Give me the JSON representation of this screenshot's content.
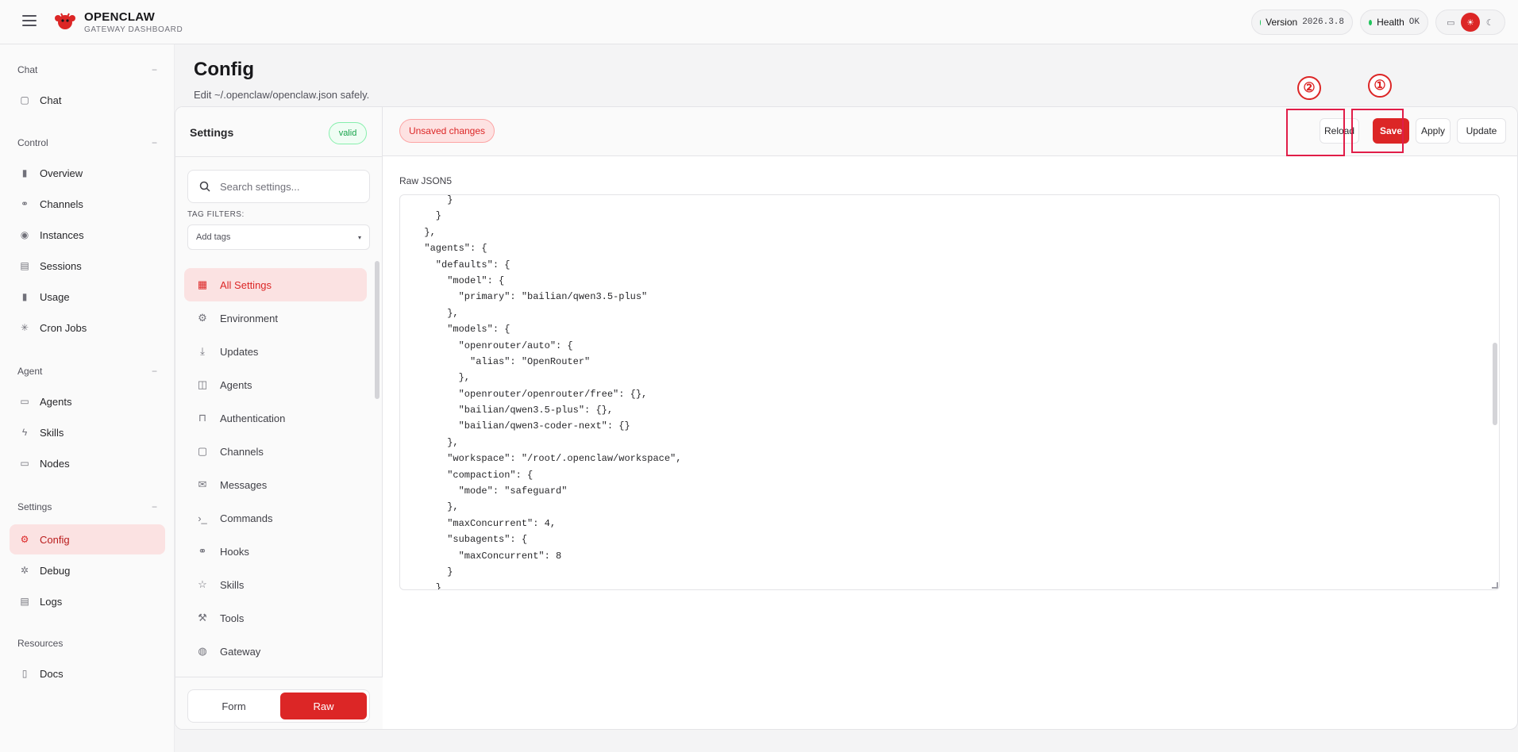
{
  "app": {
    "title": "OPENCLAW",
    "subtitle": "GATEWAY DASHBOARD"
  },
  "status": {
    "version_label": "Version",
    "version_value": "2026.3.8",
    "health_label": "Health",
    "health_value": "OK"
  },
  "theme": {
    "options": [
      "monitor-icon",
      "sun-icon",
      "moon-icon"
    ],
    "active": "sun-icon"
  },
  "nav": {
    "groups": [
      {
        "label": "Chat",
        "items": [
          {
            "label": "Chat",
            "icon": "message-icon"
          }
        ]
      },
      {
        "label": "Control",
        "items": [
          {
            "label": "Overview",
            "icon": "bar-chart-icon"
          },
          {
            "label": "Channels",
            "icon": "link-icon"
          },
          {
            "label": "Instances",
            "icon": "broadcast-icon"
          },
          {
            "label": "Sessions",
            "icon": "file-icon"
          },
          {
            "label": "Usage",
            "icon": "bar-chart-icon"
          },
          {
            "label": "Cron Jobs",
            "icon": "loader-icon"
          }
        ]
      },
      {
        "label": "Agent",
        "items": [
          {
            "label": "Agents",
            "icon": "folder-icon"
          },
          {
            "label": "Skills",
            "icon": "zap-icon"
          },
          {
            "label": "Nodes",
            "icon": "monitor-icon"
          }
        ]
      },
      {
        "label": "Settings",
        "items": [
          {
            "label": "Config",
            "icon": "gear-icon"
          },
          {
            "label": "Debug",
            "icon": "bug-icon"
          },
          {
            "label": "Logs",
            "icon": "scroll-icon"
          }
        ]
      },
      {
        "label": "Resources",
        "items": [
          {
            "label": "Docs",
            "icon": "book-icon"
          }
        ]
      }
    ],
    "collapse_symbol": "−",
    "active": "Config"
  },
  "page": {
    "title": "Config",
    "subtitle": "Edit ~/.openclaw/openclaw.json safely."
  },
  "settings_panel": {
    "title": "Settings",
    "badge": "valid",
    "search_placeholder": "Search settings...",
    "tag_filters_label": "TAG FILTERS:",
    "tag_placeholder": "Add tags",
    "sections": [
      {
        "label": "All Settings",
        "icon": "grid-icon"
      },
      {
        "label": "Environment",
        "icon": "gear-icon"
      },
      {
        "label": "Updates",
        "icon": "download-icon"
      },
      {
        "label": "Agents",
        "icon": "bot-icon"
      },
      {
        "label": "Authentication",
        "icon": "lock-icon"
      },
      {
        "label": "Channels",
        "icon": "message-icon"
      },
      {
        "label": "Messages",
        "icon": "mail-icon"
      },
      {
        "label": "Commands",
        "icon": "terminal-icon"
      },
      {
        "label": "Hooks",
        "icon": "link-icon"
      },
      {
        "label": "Skills",
        "icon": "star-icon"
      },
      {
        "label": "Tools",
        "icon": "wrench-icon"
      },
      {
        "label": "Gateway",
        "icon": "globe-icon"
      }
    ],
    "active_section": "All Settings",
    "mode_form": "Form",
    "mode_raw": "Raw",
    "mode_active": "Raw"
  },
  "toolbar": {
    "unsaved": "Unsaved changes",
    "reload": "Reload",
    "save": "Save",
    "apply": "Apply",
    "update": "Update",
    "annotation_save": "①",
    "annotation_reload": "②"
  },
  "editor": {
    "label": "Raw JSON5",
    "lines": [
      "      }",
      "    }",
      "  },",
      "  \"agents\": {",
      "    \"defaults\": {",
      "      \"model\": {",
      "        \"primary\": \"bailian/qwen3.5-plus\"",
      "      },",
      "      \"models\": {",
      "        \"openrouter/auto\": {",
      "          \"alias\": \"OpenRouter\"",
      "        },",
      "        \"openrouter/openrouter/free\": {},",
      "        \"bailian/qwen3.5-plus\": {},",
      "        \"bailian/qwen3-coder-next\": {}",
      "      },",
      "      \"workspace\": \"/root/.openclaw/workspace\",",
      "      \"compaction\": {",
      "        \"mode\": \"safeguard\"",
      "      },",
      "      \"maxConcurrent\": 4,",
      "      \"subagents\": {",
      "        \"maxConcurrent\": 8",
      "      }",
      "    }"
    ]
  },
  "colors": {
    "accent": "#dc2626",
    "accent_soft": "#fbe2e2",
    "ok": "#22c55e"
  }
}
